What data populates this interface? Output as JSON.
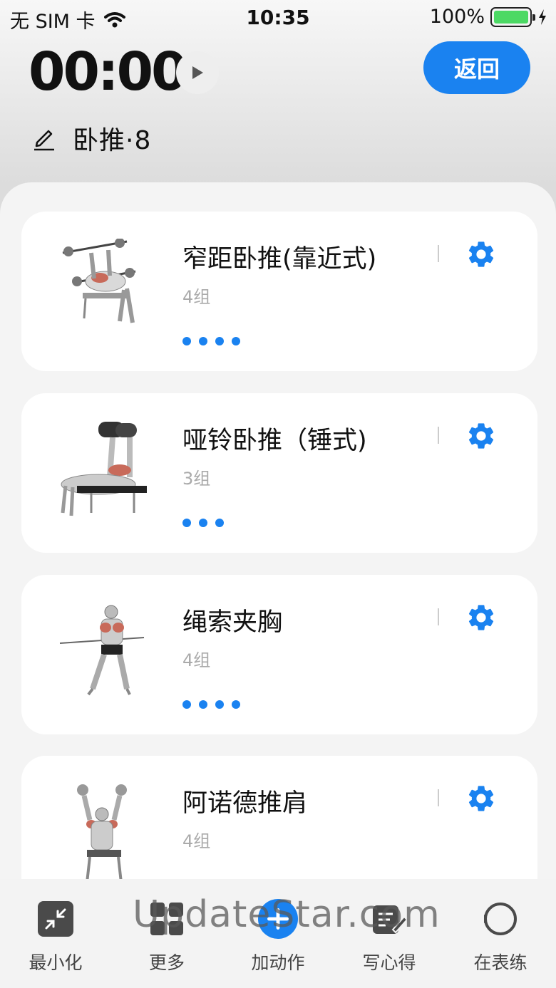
{
  "status_bar": {
    "carrier": "无 SIM 卡",
    "time": "10:35",
    "battery": "100%"
  },
  "header": {
    "timer": "00:00",
    "back_label": "返回",
    "plan_title": "卧推·8"
  },
  "exercises": [
    {
      "name": "窄距卧推(靠近式)",
      "sets": "4组",
      "dots": 4,
      "icon": "bench-press-image"
    },
    {
      "name": "哑铃卧推（锤式)",
      "sets": "3组",
      "dots": 3,
      "icon": "dumbbell-press-image"
    },
    {
      "name": "绳索夹胸",
      "sets": "4组",
      "dots": 4,
      "icon": "cable-fly-image"
    },
    {
      "name": "阿诺德推肩",
      "sets": "4组",
      "dots": 0,
      "icon": "arnold-press-image"
    }
  ],
  "bottom_nav": [
    {
      "label": "最小化",
      "icon": "minimize-icon"
    },
    {
      "label": "更多",
      "icon": "more-icon"
    },
    {
      "label": "加动作",
      "icon": "add-icon"
    },
    {
      "label": "写心得",
      "icon": "edit-note-icon"
    },
    {
      "label": "在表练",
      "icon": "watch-icon"
    }
  ],
  "watermark": "UpdateStar.com",
  "colors": {
    "accent": "#1a82f0",
    "battery": "#4cd964"
  }
}
